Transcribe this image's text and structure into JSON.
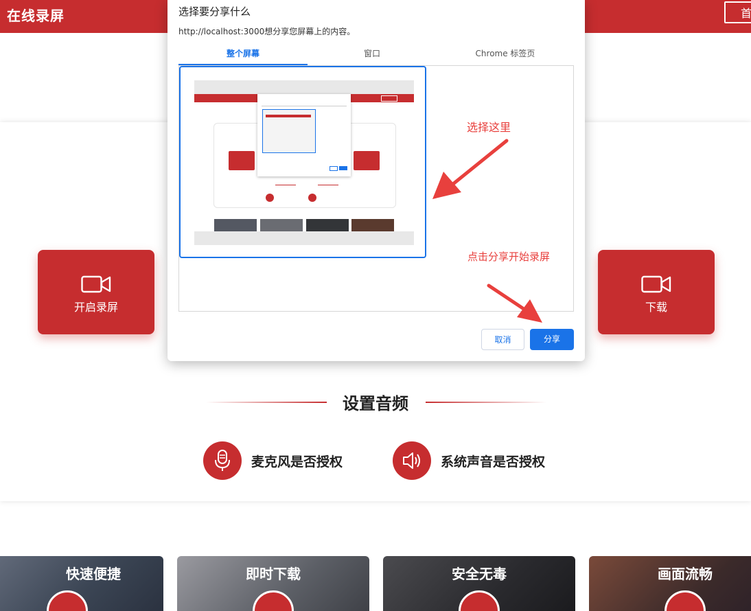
{
  "app": {
    "logo": "在线录屏",
    "nav_home": "首"
  },
  "main": {
    "start_record_label": "开启录屏",
    "download_label": "下载",
    "audio_section_title": "设置音频",
    "mic_label": "麦克风是否授权",
    "system_audio_label": "系统声音是否授权"
  },
  "features": [
    {
      "title": "快速便捷"
    },
    {
      "title": "即时下载"
    },
    {
      "title": "安全无毒"
    },
    {
      "title": "画面流畅"
    }
  ],
  "dialog": {
    "title": "选择要分享什么",
    "subtitle": "http://localhost:3000想分享您屏幕上的内容。",
    "tabs": [
      "整个屏幕",
      "窗口",
      "Chrome 标签页"
    ],
    "cancel_label": "取消",
    "share_label": "分享"
  },
  "annotations": {
    "select_here": "选择这里",
    "click_share": "点击分享开始录屏"
  },
  "colors": {
    "brand_red": "#c62d2f",
    "accent_blue": "#1a73e8",
    "annotation_red": "#e8403d"
  }
}
